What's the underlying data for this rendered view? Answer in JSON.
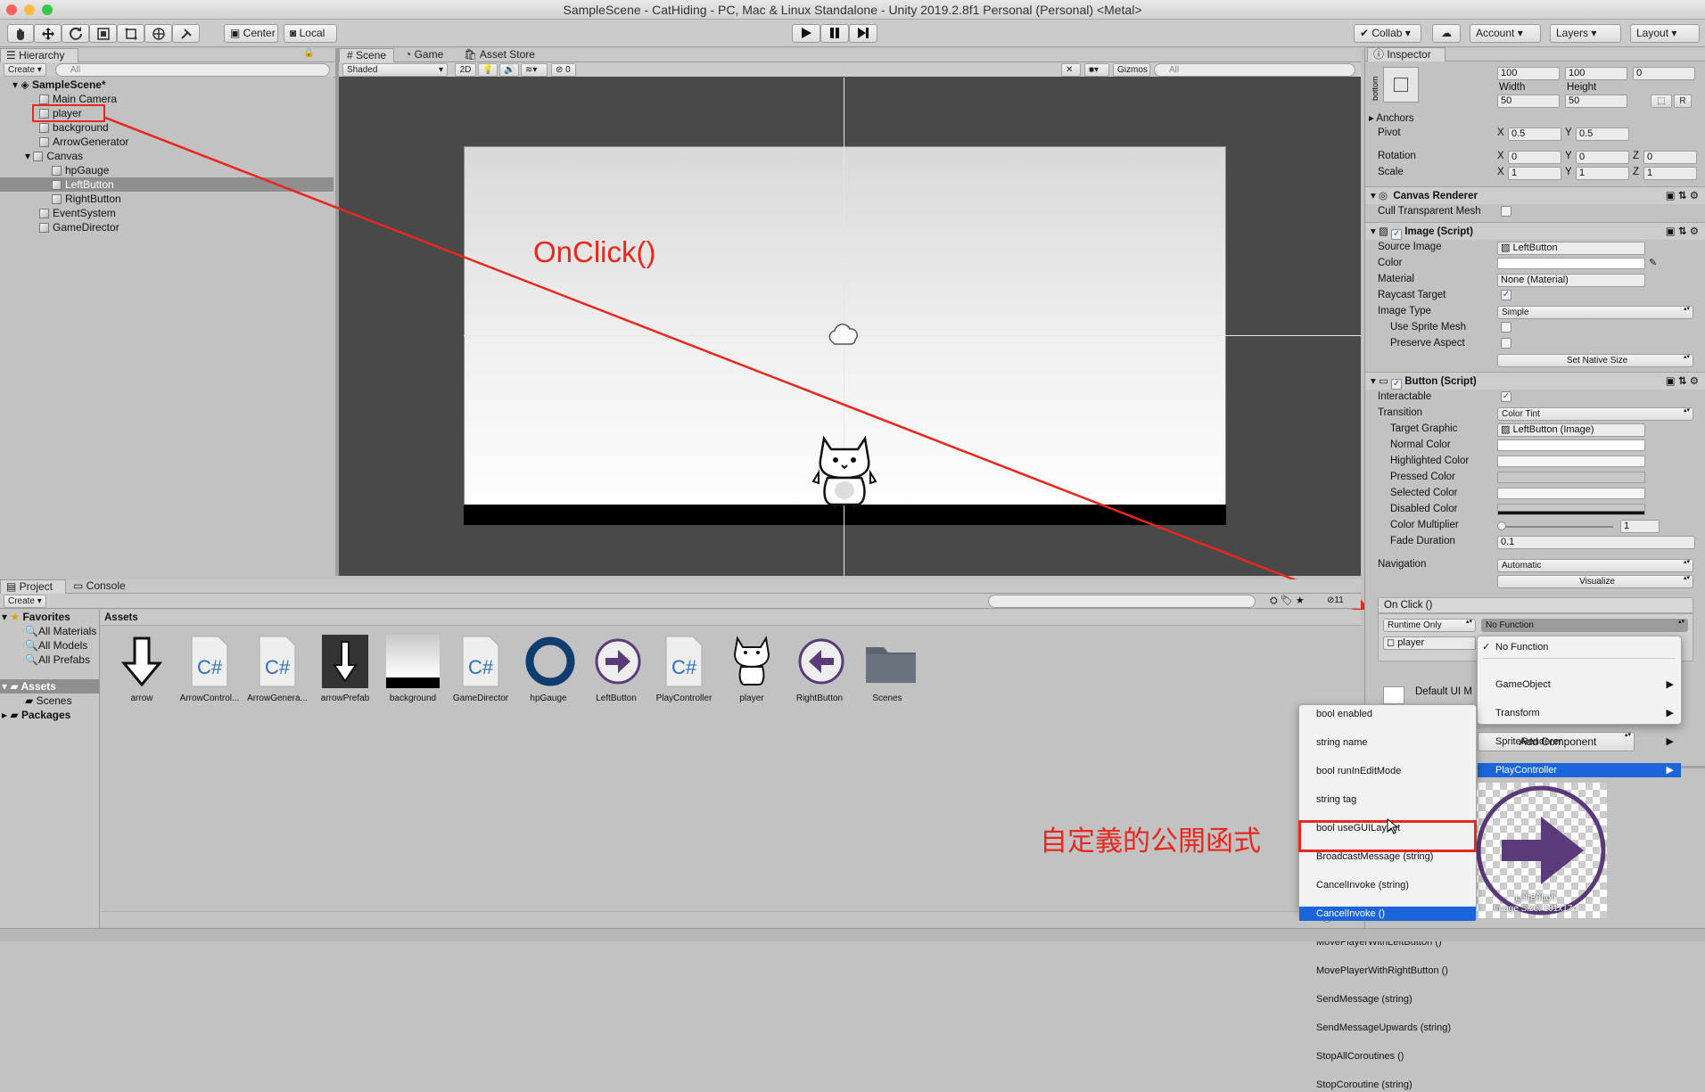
{
  "window": {
    "title": "SampleScene - CatHiding - PC, Mac & Linux Standalone - Unity 2019.2.8f1 Personal (Personal) <Metal>"
  },
  "toolbar": {
    "center_label": "Center",
    "local_label": "Local",
    "collab_label": "Collab",
    "account_label": "Account",
    "layers_label": "Layers",
    "layout_label": "Layout"
  },
  "hierarchy": {
    "tab": "Hierarchy",
    "create": "Create",
    "search_placeholder": "All",
    "scene": "SampleScene*",
    "items": [
      "Main Camera",
      "player",
      "background",
      "ArrowGenerator",
      "Canvas",
      "hpGauge",
      "LeftButton",
      "RightButton",
      "EventSystem",
      "GameDirector"
    ]
  },
  "scene": {
    "tabs": [
      "Scene",
      "Game",
      "Asset Store"
    ],
    "shading": "Shaded",
    "mode_2d": "2D",
    "fx_count": "0",
    "gizmos": "Gizmos",
    "search_placeholder": "All"
  },
  "annotations": {
    "onclick": "OnClick()",
    "custom_func": "自定義的公開函式"
  },
  "inspector": {
    "tab": "Inspector",
    "anchor_preset": "bottom",
    "rect": {
      "pos": [
        "100",
        "100",
        "0"
      ],
      "width_label": "Width",
      "height_label": "Height",
      "width": "50",
      "height": "50",
      "r_btn": "R"
    },
    "anchors": "Anchors",
    "pivot": {
      "label": "Pivot",
      "x": "0.5",
      "y": "0.5"
    },
    "rotation": {
      "label": "Rotation",
      "x": "0",
      "y": "0",
      "z": "0"
    },
    "scale": {
      "label": "Scale",
      "x": "1",
      "y": "1",
      "z": "1"
    },
    "axis": {
      "x": "X",
      "y": "Y",
      "z": "Z"
    },
    "canvas_renderer": {
      "title": "Canvas Renderer",
      "cull": "Cull Transparent Mesh"
    },
    "image": {
      "title": "Image (Script)",
      "source_label": "Source Image",
      "source": "LeftButton",
      "color": "Color",
      "material_label": "Material",
      "material": "None (Material)",
      "raycast": "Raycast Target",
      "type_label": "Image Type",
      "type": "Simple",
      "sprite_mesh": "Use Sprite Mesh",
      "preserve": "Preserve Aspect",
      "native": "Set Native Size"
    },
    "button": {
      "title": "Button (Script)",
      "interactable": "Interactable",
      "transition_label": "Transition",
      "transition": "Color Tint",
      "target_label": "Target Graphic",
      "target": "LeftButton (Image)",
      "normal": "Normal Color",
      "highlighted": "Highlighted Color",
      "pressed": "Pressed Color",
      "selected": "Selected Color",
      "disabled": "Disabled Color",
      "multiplier_label": "Color Multiplier",
      "multiplier": "1",
      "fade_label": "Fade Duration",
      "fade": "0.1",
      "nav_label": "Navigation",
      "nav": "Automatic",
      "visualize": "Visualize"
    },
    "onclick": {
      "title": "On Click ()",
      "runtime": "Runtime Only",
      "function": "No Function",
      "object": "player"
    },
    "default_material": "Default UI M",
    "add_component": "Add Component"
  },
  "function_menu": {
    "items": [
      "No Function",
      "GameObject",
      "Transform",
      "SpriteRenderer",
      "PlayController"
    ],
    "selected": "PlayController"
  },
  "method_menu": {
    "items": [
      "bool enabled",
      "string name",
      "bool runInEditMode",
      "string tag",
      "bool useGUILayout",
      "BroadcastMessage (string)",
      "CancelInvoke (string)",
      "CancelInvoke ()",
      "MovePlayerWithLeftButton ()",
      "MovePlayerWithRightButton ()",
      "SendMessage (string)",
      "SendMessageUpwards (string)",
      "StopAllCoroutines ()",
      "StopCoroutine (string)"
    ],
    "selected": "CancelInvoke ()"
  },
  "project": {
    "tabs": [
      "Project",
      "Console"
    ],
    "create": "Create",
    "count": "11",
    "favorites": "Favorites",
    "fav_items": [
      "All Materials",
      "All Models",
      "All Prefabs"
    ],
    "assets": "Assets",
    "scenes": "Scenes",
    "packages": "Packages",
    "breadcrumb": "Assets",
    "files": [
      "arrow",
      "ArrowControl...",
      "ArrowGenera...",
      "arrowPrefab",
      "background",
      "GameDirector",
      "hpGauge",
      "LeftButton",
      "PlayController",
      "player",
      "RightButton",
      "Scenes"
    ]
  },
  "preview": {
    "name": "LeftButton",
    "size": "Image Size: 181x174"
  },
  "colors": {
    "annotation": "#e8281e",
    "selection": "#1c64d9",
    "arrow_purple": "#5b3a7a",
    "gauge_blue": "#0f3d6e"
  }
}
